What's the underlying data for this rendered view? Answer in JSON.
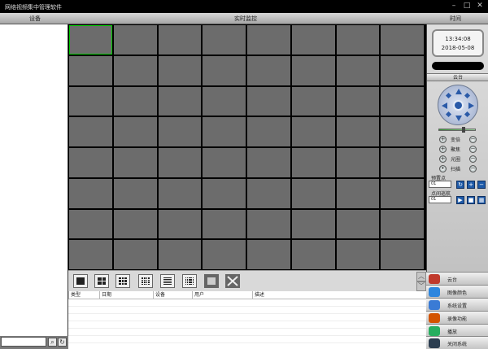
{
  "window": {
    "title": "网络视频集中管理软件",
    "min": "–",
    "max": "□",
    "close": "✕"
  },
  "header": {
    "device": "设备",
    "live": "实时监控",
    "time": "时间"
  },
  "clock": {
    "time": "13:34:08",
    "date": "2018-05-08"
  },
  "ptz": {
    "title": "云台",
    "controls": [
      {
        "label": "变倍"
      },
      {
        "label": "聚焦"
      },
      {
        "label": "光圈"
      },
      {
        "label": "扫描"
      }
    ],
    "preset_label": "预置点",
    "preset_value": "01",
    "cruise_label": "点间巡航",
    "cruise_value": "01"
  },
  "log": {
    "columns": [
      "类型",
      "日期",
      "设备",
      "用户",
      "描述"
    ]
  },
  "menu": [
    {
      "label": "云台",
      "color": "#c0392b"
    },
    {
      "label": "图像颜色",
      "color": "#2e86de"
    },
    {
      "label": "系统设置",
      "color": "#3a7bd5"
    },
    {
      "label": "录像功能",
      "color": "#d35400"
    },
    {
      "label": "播放",
      "color": "#27ae60"
    },
    {
      "label": "关闭系统",
      "color": "#2c3e50"
    }
  ],
  "colors": {
    "cell": "#6c6c6c",
    "selected": "#00cc00",
    "accent": "#1e5aa8"
  },
  "icons": {
    "close": "close-icon",
    "minimize": "minimize-icon",
    "maximize": "maximize-icon",
    "search": "search-icon",
    "refresh": "refresh-icon"
  }
}
